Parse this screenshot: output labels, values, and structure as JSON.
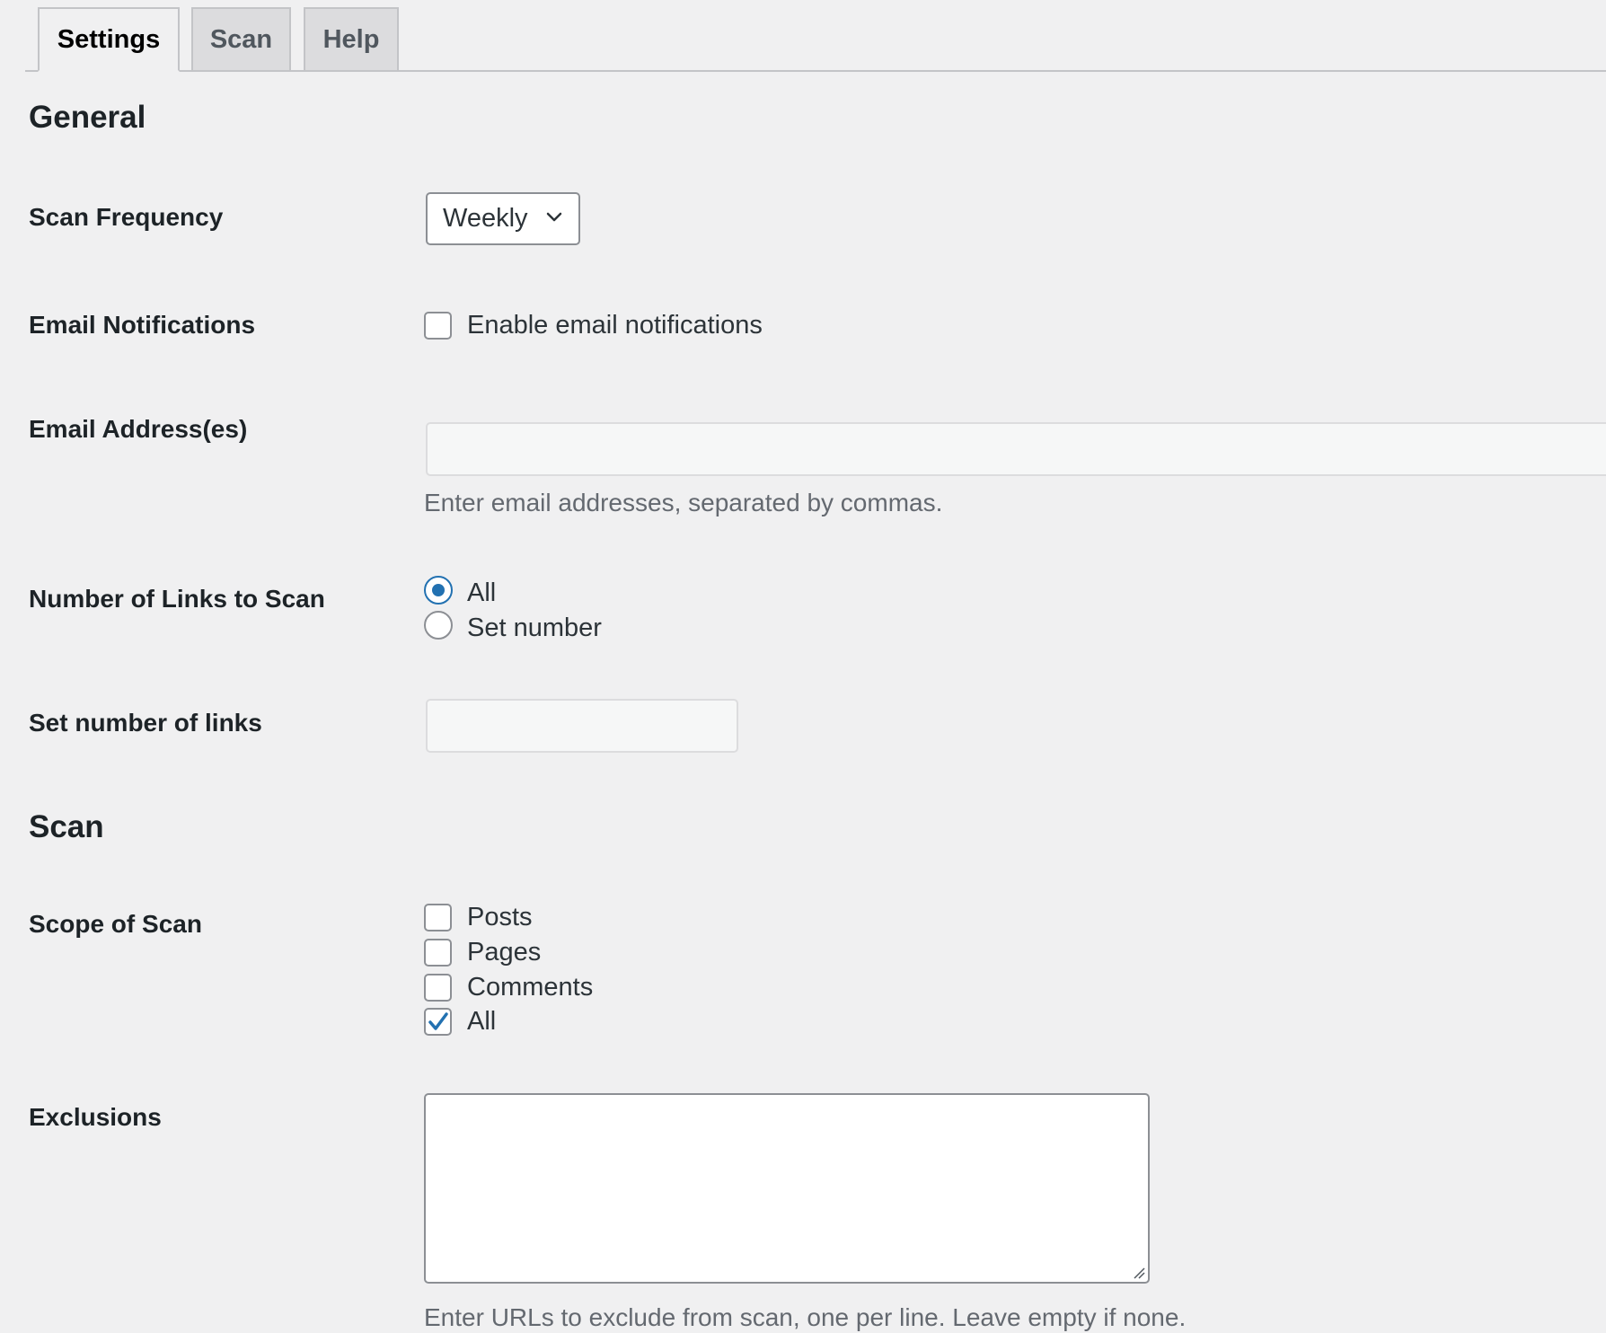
{
  "tabs": [
    {
      "label": "Settings",
      "active": true
    },
    {
      "label": "Scan",
      "active": false
    },
    {
      "label": "Help",
      "active": false
    }
  ],
  "general": {
    "title": "General",
    "scan_frequency": {
      "label": "Scan Frequency",
      "selected": "Weekly"
    },
    "email_notifications": {
      "label": "Email Notifications",
      "checkbox_label": "Enable email notifications",
      "checked": false
    },
    "email_addresses": {
      "label": "Email Address(es)",
      "value": "",
      "help": "Enter email addresses, separated by commas."
    },
    "links_to_scan": {
      "label": "Number of Links to Scan",
      "options": [
        {
          "label": "All",
          "checked": true
        },
        {
          "label": "Set number",
          "checked": false
        }
      ]
    },
    "set_number": {
      "label": "Set number of links",
      "value": ""
    }
  },
  "scan": {
    "title": "Scan",
    "scope": {
      "label": "Scope of Scan",
      "options": [
        {
          "label": "Posts",
          "checked": false
        },
        {
          "label": "Pages",
          "checked": false
        },
        {
          "label": "Comments",
          "checked": false
        },
        {
          "label": "All",
          "checked": true
        }
      ]
    },
    "exclusions": {
      "label": "Exclusions",
      "value": "",
      "help": "Enter URLs to exclude from scan, one per line. Leave empty if none."
    }
  },
  "colors": {
    "accent": "#2271b1",
    "background": "#f0f0f1",
    "border": "#8c8f94",
    "help_text": "#646970"
  },
  "icons": {
    "select_arrow": "chevron-down-icon",
    "checkmark": "checkmark-icon",
    "resize": "resize-grip-icon"
  }
}
